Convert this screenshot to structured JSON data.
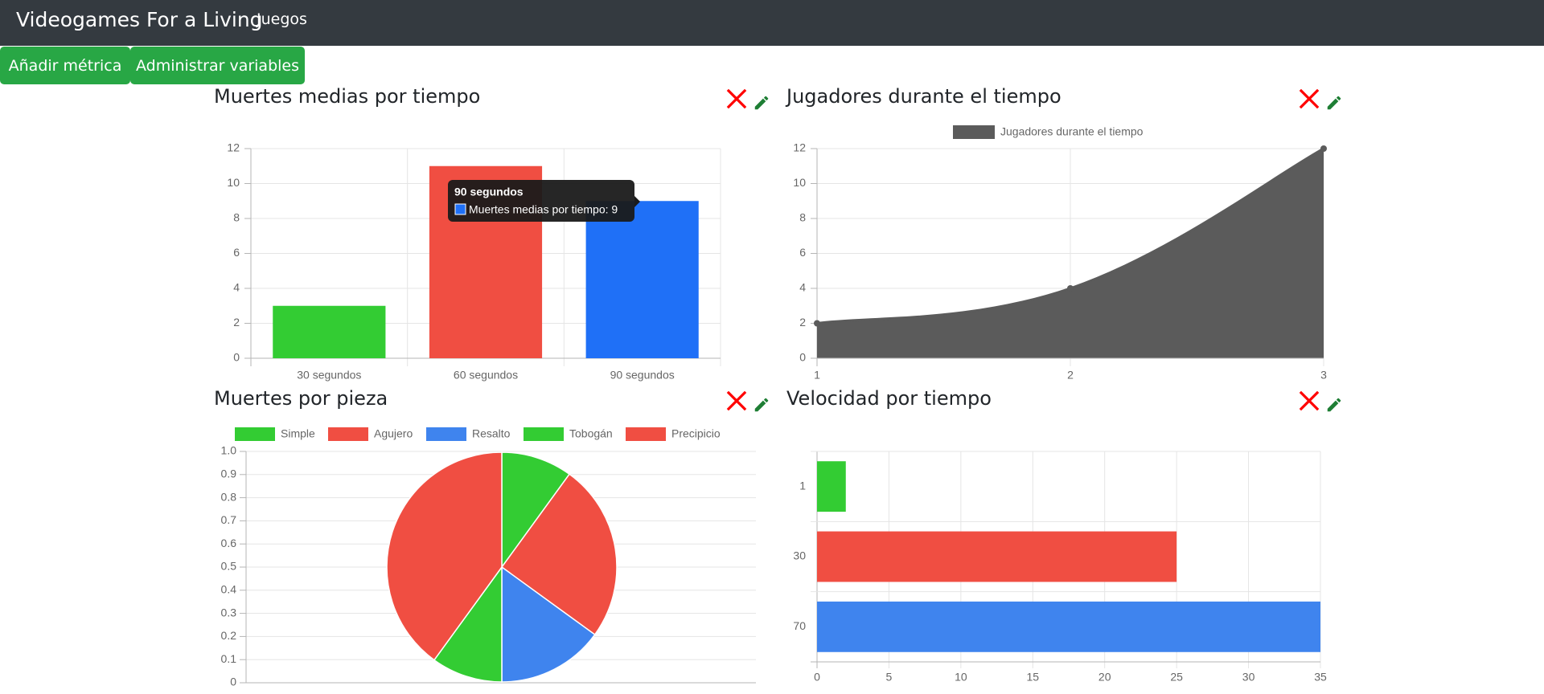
{
  "navbar": {
    "brand": "Videogames For a Living",
    "link": "Juegos"
  },
  "toolbar": {
    "add_metric": "Añadir métrica",
    "manage_vars": "Administrar variables"
  },
  "colors": {
    "navbar_bg": "#343a40",
    "button_green": "#28a745",
    "delete_red": "#ff0000",
    "edit_green": "#1e7e34",
    "series_green": "#33cc33",
    "series_red": "#f04e42",
    "series_blue": "#1f70f7",
    "series_lightblue": "#3f84ee",
    "series_gray": "#5b5b5b",
    "tooltip_bg": "#1a1a1a"
  },
  "icons": {
    "delete": "close-icon",
    "edit": "pencil-icon"
  },
  "cards": [
    {
      "title": "Muertes medias por tiempo"
    },
    {
      "title": "Jugadores durante el tiempo"
    },
    {
      "title": "Muertes por pieza"
    },
    {
      "title": "Velocidad por tiempo"
    }
  ],
  "chart_data": [
    {
      "type": "bar",
      "title": "Muertes medias por tiempo",
      "categories": [
        "30 segundos",
        "60 segundos",
        "90 segundos"
      ],
      "series": [
        {
          "name": "Muertes medias por tiempo",
          "values": [
            3,
            11,
            9
          ]
        }
      ],
      "colors": [
        "#33cc33",
        "#f04e42",
        "#1f70f7"
      ],
      "ylim": [
        0,
        12
      ],
      "yticks": [
        "0",
        "2",
        "4",
        "6",
        "8",
        "10",
        "12"
      ],
      "grid": true,
      "tooltip": {
        "title": "90 segundos",
        "label": "Muertes medias por tiempo: 9"
      }
    },
    {
      "type": "area",
      "title": "Jugadores durante el tiempo",
      "x": [
        1,
        2,
        3
      ],
      "xticks": [
        "1",
        "2",
        "3"
      ],
      "series": [
        {
          "name": "Jugadores durante el tiempo",
          "values": [
            2,
            4,
            12
          ]
        }
      ],
      "ylim": [
        0,
        12
      ],
      "yticks": [
        "0",
        "2",
        "4",
        "6",
        "8",
        "10",
        "12"
      ],
      "legend": "top",
      "grid": true
    },
    {
      "type": "pie",
      "title": "Muertes por pieza",
      "labels": [
        "Simple",
        "Agujero",
        "Resalto",
        "Tobogán",
        "Precipicio"
      ],
      "values": [
        10,
        25,
        15,
        10,
        40
      ],
      "colors": [
        "#33cc33",
        "#f04e42",
        "#3f84ee",
        "#33cc33",
        "#f04e42"
      ],
      "yticks": [
        "0",
        "0.1",
        "0.2",
        "0.3",
        "0.4",
        "0.5",
        "0.6",
        "0.7",
        "0.8",
        "0.9",
        "1.0"
      ],
      "legend": "top",
      "grid": true
    },
    {
      "type": "bar",
      "orientation": "horizontal",
      "title": "Velocidad por tiempo",
      "categories": [
        "1",
        "30",
        "70"
      ],
      "values": [
        2,
        25,
        35
      ],
      "colors": [
        "#33cc33",
        "#f04e42",
        "#3f84ee"
      ],
      "xlim": [
        0,
        35
      ],
      "xticks": [
        "0",
        "5",
        "10",
        "15",
        "20",
        "25",
        "30",
        "35"
      ],
      "grid": true
    }
  ]
}
